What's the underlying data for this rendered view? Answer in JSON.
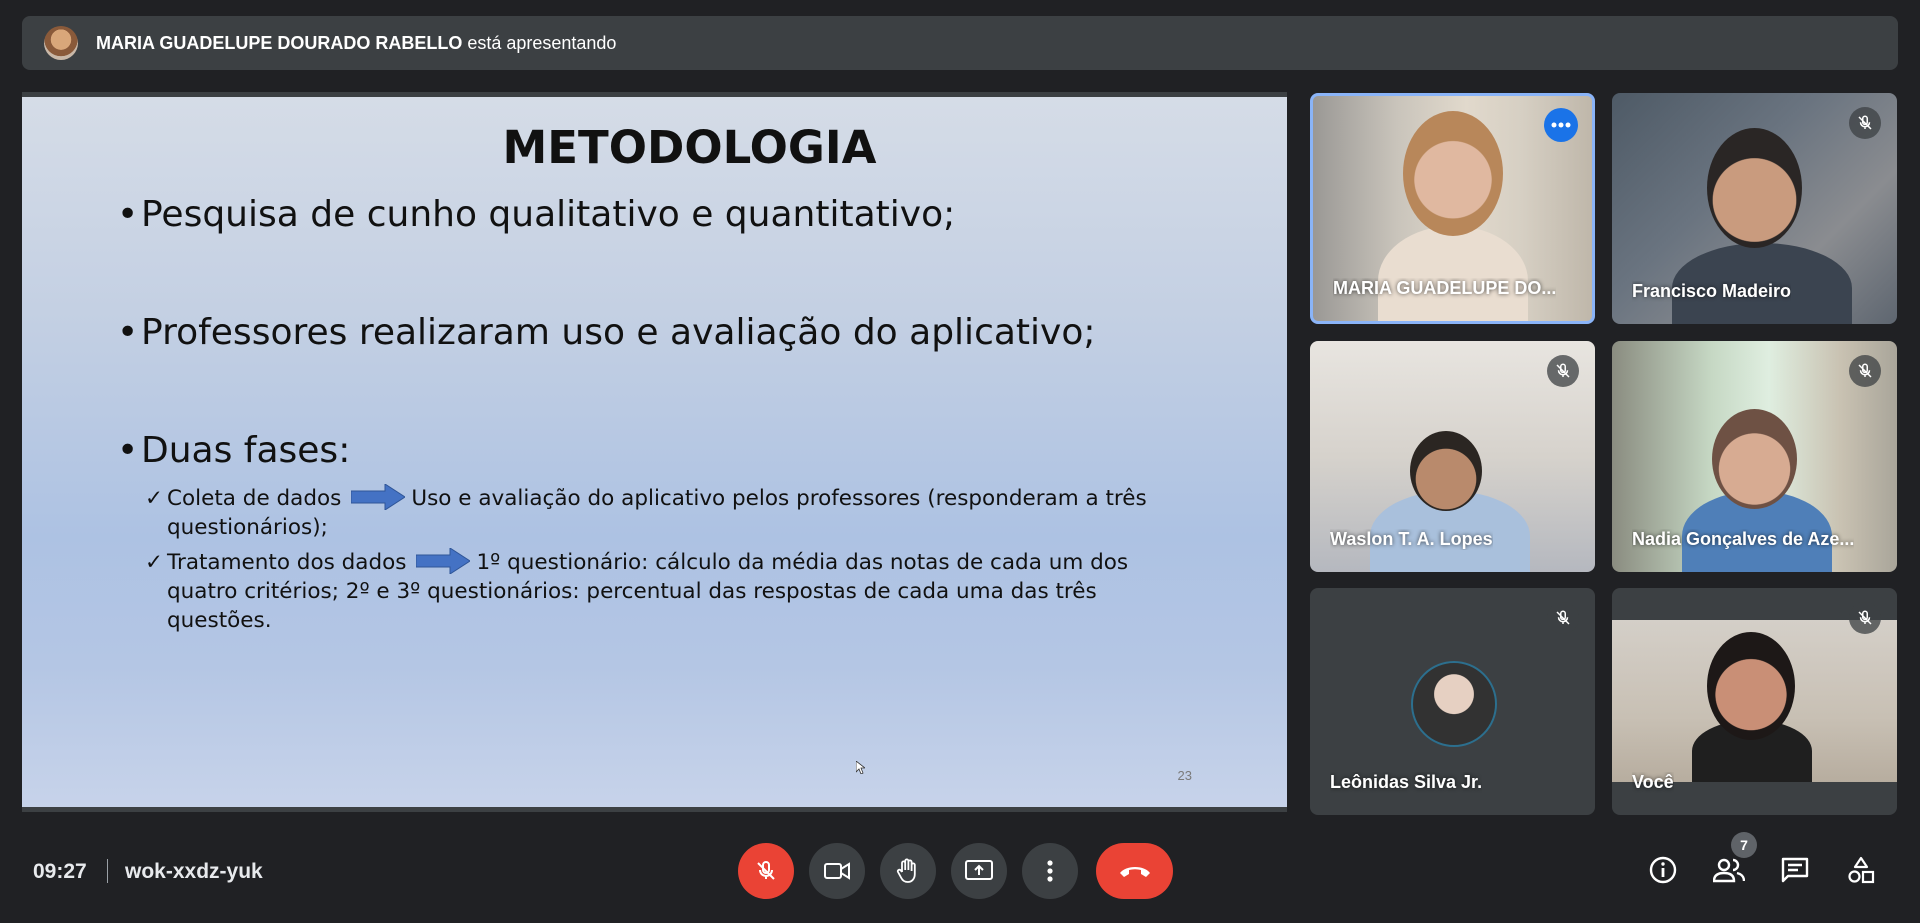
{
  "banner": {
    "presenter_name": "MARIA GUADELUPE DOURADO RABELLO",
    "presenting_text": " está apresentando"
  },
  "slide": {
    "title": "METODOLOGIA",
    "bullets": [
      "Pesquisa de cunho qualitativo e quantitativo;",
      "Professores realizaram uso e avaliação do aplicativo;",
      "Duas fases:"
    ],
    "sub_items": [
      {
        "label": "Coleta de dados",
        "text": "Uso e avaliação do aplicativo pelos professores (responderam a três questionários);"
      },
      {
        "label": "Tratamento dos dados",
        "text": "1º questionário: cálculo da média das notas de cada um dos quatro critérios; 2º e 3º questionários: percentual das respostas de cada uma das três questões."
      }
    ],
    "page_number": "23",
    "arrow_color": "#4472c4"
  },
  "participants": [
    {
      "name": "MARIA GUADELUPE DO...",
      "muted": false,
      "active": true
    },
    {
      "name": "Francisco Madeiro",
      "muted": true
    },
    {
      "name": "Waslon T. A. Lopes",
      "muted": true
    },
    {
      "name": "Nadia Gonçalves de Aze...",
      "muted": true
    },
    {
      "name": "Leônidas Silva Jr.",
      "muted": true,
      "video": false
    },
    {
      "name": "Você",
      "muted": true
    }
  ],
  "bottom_bar": {
    "time": "09:27",
    "meeting_code": "wok-xxdz-yuk",
    "people_count": "7"
  },
  "colors": {
    "background": "#202124",
    "surface": "#3c4043",
    "danger": "#ea4335",
    "accent": "#1a73e8"
  }
}
